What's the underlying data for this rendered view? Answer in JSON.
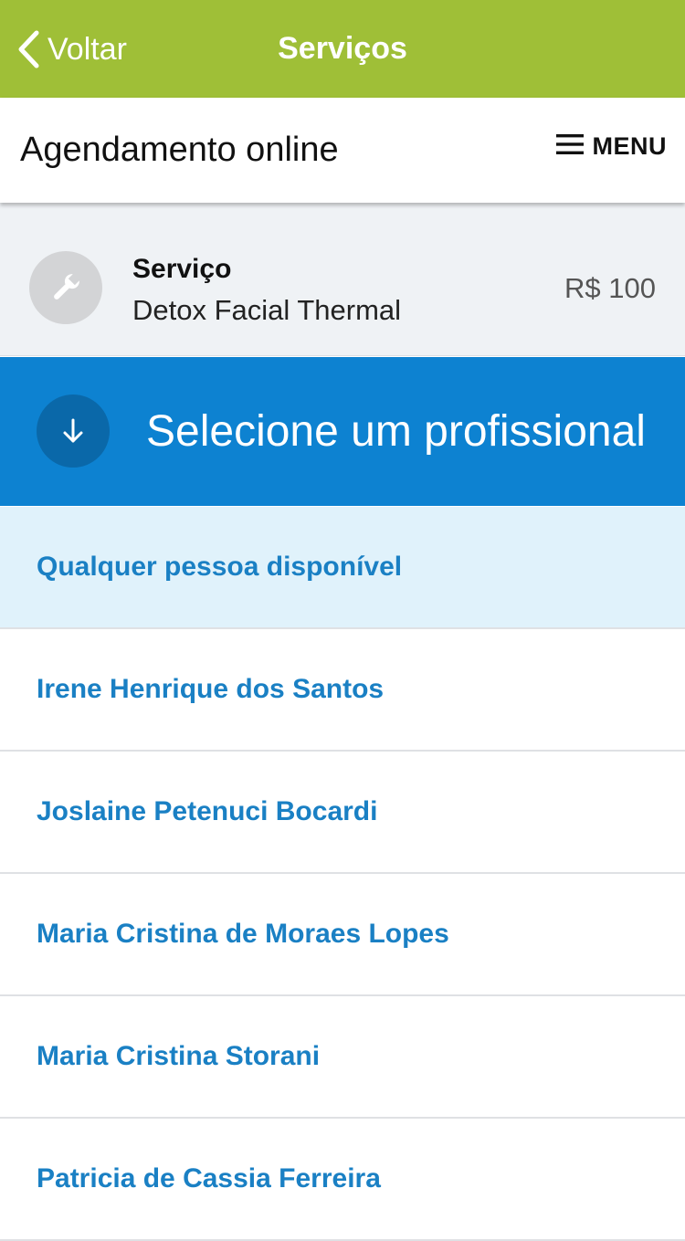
{
  "top_bar": {
    "back_label": "Voltar",
    "title": "Serviços"
  },
  "header": {
    "title": "Agendamento online",
    "menu_label": "MENU"
  },
  "service": {
    "kind_label": "Serviço",
    "name": "Detox Facial Thermal",
    "price": "R$ 100",
    "icon": "wrench-icon"
  },
  "select": {
    "title": "Selecione um profissional",
    "icon": "arrow-down-icon"
  },
  "professionals": [
    "Qualquer pessoa disponível",
    "Irene Henrique dos Santos",
    "Joslaine Petenuci Bocardi",
    "Maria Cristina de Moraes Lopes",
    "Maria Cristina Storani",
    "Patricia de Cassia Ferreira"
  ],
  "colors": {
    "top_bar": "#9fbf37",
    "banner": "#0d82d1",
    "link": "#1a80c4",
    "highlight_row": "#e0f2fb"
  }
}
